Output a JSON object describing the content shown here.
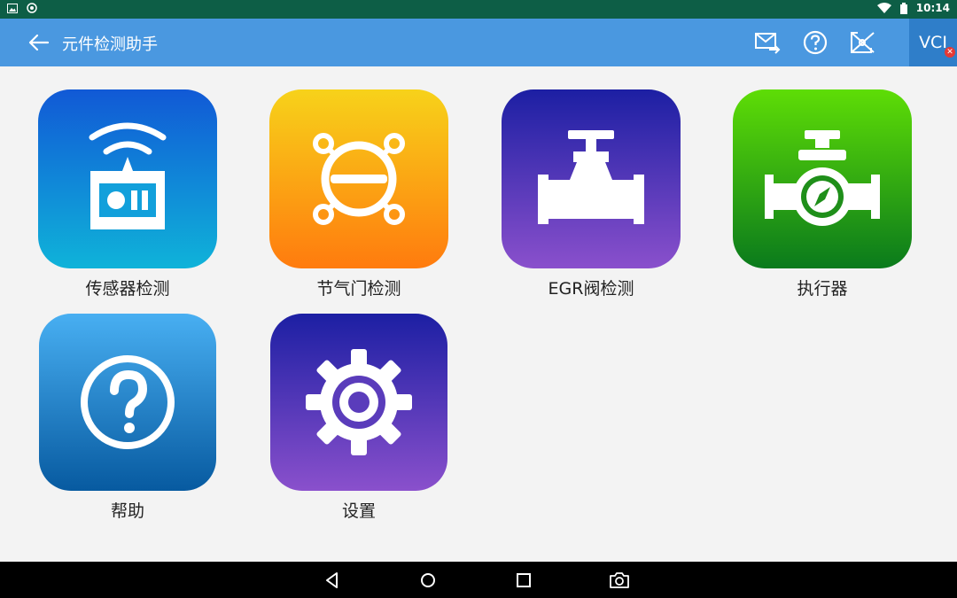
{
  "statusbar": {
    "time": "10:14"
  },
  "appbar": {
    "title": "元件检测助手",
    "vci_label": "VCI"
  },
  "tiles": [
    {
      "label": "传感器检测"
    },
    {
      "label": "节气门检测"
    },
    {
      "label": "EGR阀检测"
    },
    {
      "label": "执行器"
    },
    {
      "label": "帮助"
    },
    {
      "label": "设置"
    }
  ],
  "colors": {
    "statusbar": "#0d5e46",
    "appbar": "#4a98e0",
    "background": "#f3f3f3",
    "vci_error": "#e53935"
  },
  "icons": [
    "back-arrow-icon",
    "mail-forward-icon",
    "help-circle-icon",
    "share-icon",
    "sensor-icon",
    "throttle-icon",
    "valve-icon",
    "actuator-icon",
    "help-icon",
    "gear-icon",
    "nav-back-icon",
    "nav-home-icon",
    "nav-recents-icon",
    "screenshot-icon"
  ]
}
